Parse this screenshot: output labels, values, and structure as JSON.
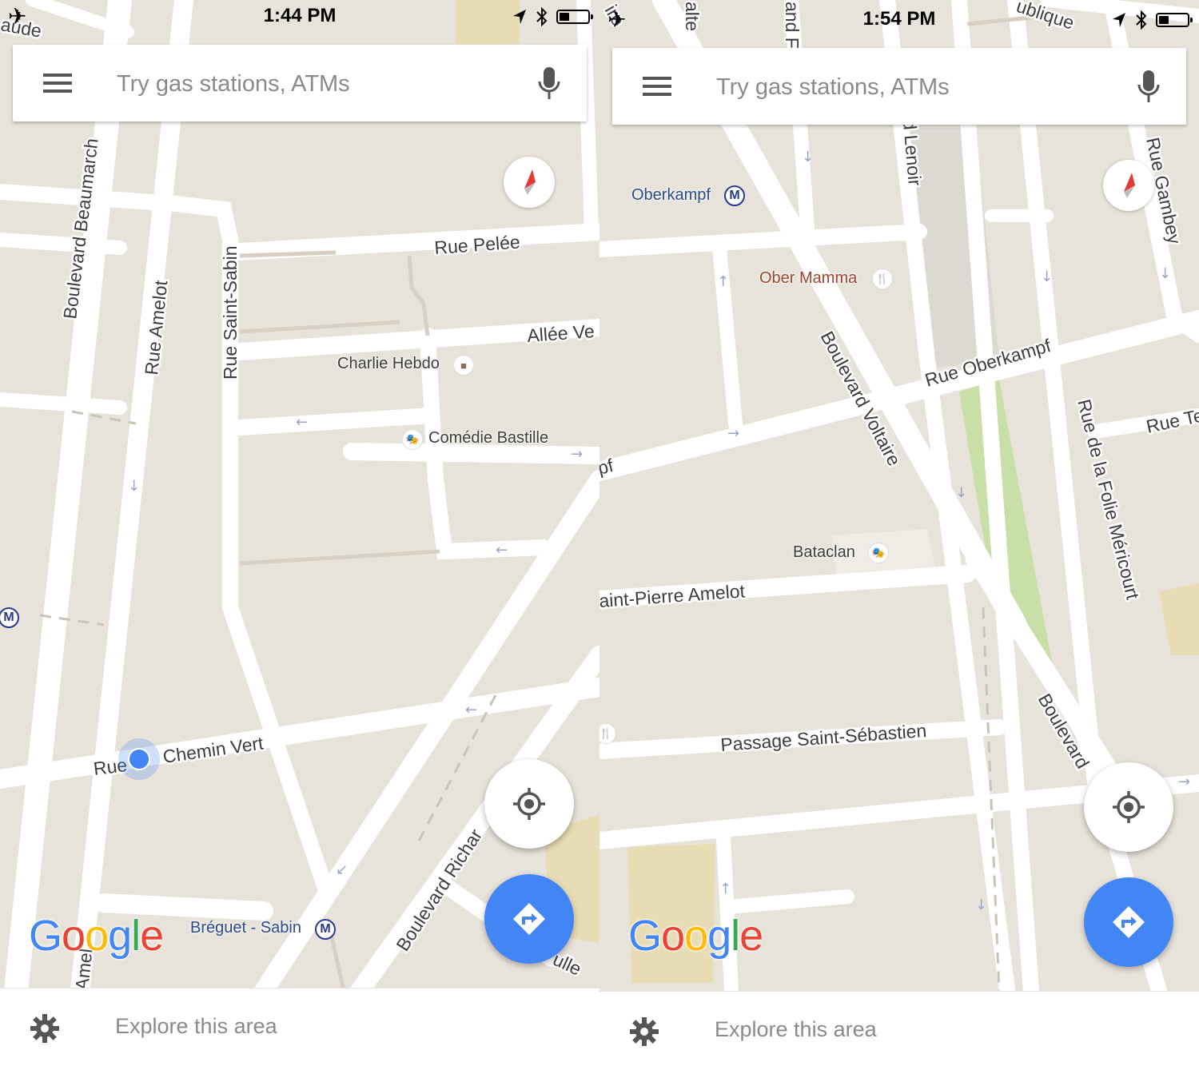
{
  "left": {
    "status": {
      "time": "1:44 PM"
    },
    "search": {
      "placeholder": "Try gas stations, ATMs"
    },
    "streets": {
      "s0": "aude",
      "s1": "Boulevard Beaumarch",
      "s2": "Rue Amelot",
      "s3": "Rue Saint-Sabin",
      "s4": "Rue Pelée",
      "s5": "Allée Ve",
      "s6": "Rue",
      "s7": "Chemin Vert",
      "s8": "Boulevard Richar",
      "s9": "ulle",
      "s10": "Amel"
    },
    "pois": {
      "charlie": "Charlie Hebdo",
      "comedie": "Comédie Bastille",
      "breguet": "Bréguet - Sabin"
    },
    "logo": {
      "g1": "G",
      "o1": "o",
      "o2": "o",
      "g2": "g",
      "l": "l",
      "e": "e"
    },
    "bottom": {
      "explore": "Explore this area"
    }
  },
  "right": {
    "status": {
      "time": "1:54 PM"
    },
    "search": {
      "placeholder": "Try gas stations, ATMs"
    },
    "streets": {
      "s0": "ire",
      "s1": "alte",
      "s2": "and F",
      "s3": "ublique",
      "s4": "ard Lenoir",
      "s5": "Rue Gambey",
      "s6": "Rue Oberkampf",
      "s7": "Boulevard Voltaire",
      "s8": "Rue Te",
      "s9": "pf",
      "s10": "Rue de la Folie Méricourt",
      "s11": "aint-Pierre Amelot",
      "s12": "Passage Saint-Sébastien",
      "s13": "Boulevard"
    },
    "pois": {
      "oberkampf": "Oberkampf",
      "obermamma": "Ober Mamma",
      "bataclan": "Bataclan"
    },
    "logo": {
      "g1": "G",
      "o1": "o",
      "o2": "o",
      "g2": "g",
      "l": "l",
      "e": "e"
    },
    "bottom": {
      "explore": "Explore this area"
    }
  },
  "icons": {
    "airplane": "airplane-icon",
    "location_arrow": "location-arrow-icon",
    "bluetooth": "bluetooth-icon",
    "battery": "battery-icon",
    "menu": "hamburger-menu-icon",
    "mic": "microphone-icon",
    "compass": "compass-icon",
    "my_location": "my-location-icon",
    "directions": "directions-icon",
    "settings": "gear-icon",
    "metro": "metro-icon",
    "theater": "theater-icon",
    "restaurant": "restaurant-icon",
    "shop": "shop-icon",
    "metro_glyph": "M",
    "theater_glyph": "🎭",
    "restaurant_glyph": "🍴"
  },
  "colors": {
    "map_bg": "#e8e3da",
    "road": "#ffffff",
    "park": "#c8dfa8",
    "accent_blue": "#4285f4",
    "google_blue": "#4285f4",
    "google_red": "#ea4335",
    "google_yellow": "#fbbc05",
    "google_green": "#34a853"
  }
}
